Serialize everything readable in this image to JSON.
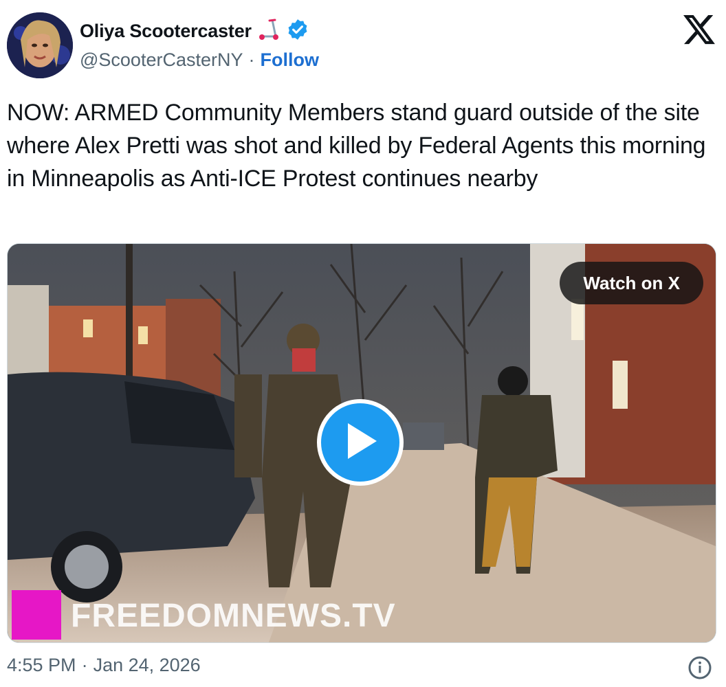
{
  "author": {
    "display_name": "Oliya Scootercaster",
    "handle": "@ScooterCasterNY",
    "separator": "·",
    "follow_label": "Follow",
    "verified_color": "#1d9bf0",
    "icons": [
      "scooter-icon",
      "verified-badge-icon"
    ]
  },
  "tweet": {
    "text": "NOW: ARMED Community Members stand guard outside of the site where Alex Pretti was shot and killed by Federal Agents this morning in Minneapolis as Anti-ICE Protest continues nearby"
  },
  "media": {
    "watch_label": "Watch on X",
    "watermark": "FREEDOMNEWS.TV",
    "watermark_color": "#e617c6",
    "play_color": "#1d9bf0"
  },
  "footer": {
    "time": "4:55 PM",
    "separator": "·",
    "date": "Jan 24, 2026",
    "info_icon": "info-icon"
  },
  "brand": {
    "logo": "x-logo-icon"
  }
}
